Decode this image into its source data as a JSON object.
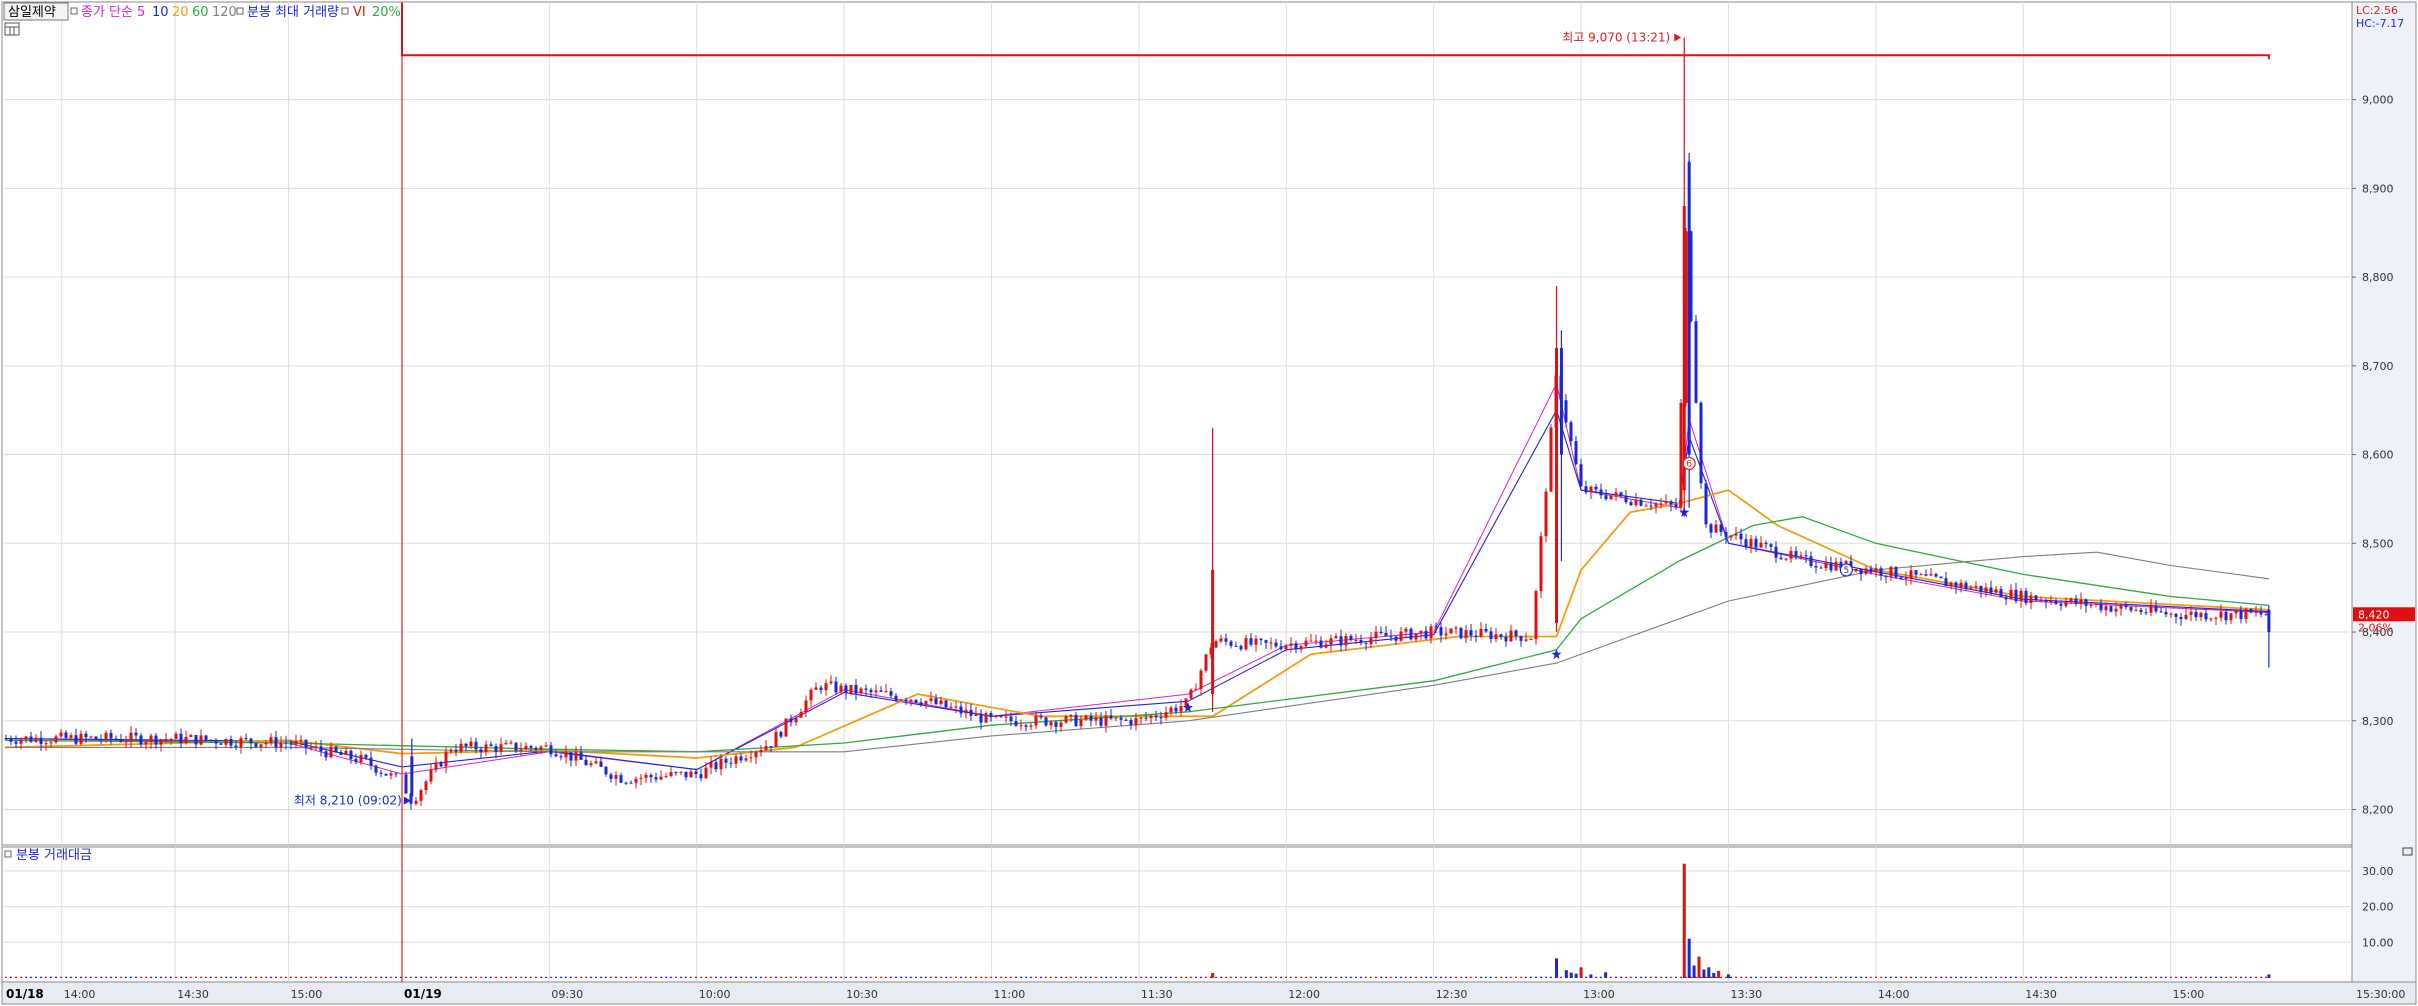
{
  "legend": {
    "stock_name": "삼일제약",
    "ma_label": "종가 단순",
    "ma_periods": [
      "5",
      "10",
      "20",
      "60",
      "120"
    ],
    "ma_colors": [
      "#e01fd0",
      "#1a28d4",
      "#f39c12",
      "#2eaa3e",
      "#7f7f7f"
    ],
    "volume_overlay_label": "분봉 최대 거래량",
    "vi_label": "VI",
    "vi_pct": "20%"
  },
  "corner": {
    "lc": "LC:2.56",
    "hc": "HC:-7.17"
  },
  "annotations": {
    "high_label": "최고 9,070 (13:21)",
    "low_label": "최저 8,210 (09:02)",
    "current_price": "8,420",
    "current_change": "2.06%",
    "marker_six": "6",
    "marker_five": "5"
  },
  "volume_panel": {
    "title": "분봉 거래대금",
    "y_labels": [
      "30.00",
      "20.00",
      "10.00"
    ]
  },
  "time_axis": {
    "date_labels": [
      "01/18",
      "01/19"
    ],
    "labels": [
      "14:00",
      "14:30",
      "15:00",
      "09:30",
      "10:00",
      "10:30",
      "11:00",
      "11:30",
      "12:00",
      "12:30",
      "13:00",
      "13:30",
      "14:00",
      "14:30",
      "15:00",
      "15:30:00"
    ]
  },
  "chart_data": {
    "type": "candlestick",
    "y_ticks": [
      8200,
      8300,
      8400,
      8500,
      8600,
      8700,
      8800,
      8900,
      9000
    ],
    "y_tick_labels": [
      "8,200",
      "8,300",
      "8,400",
      "8,500",
      "8,600",
      "8,700",
      "8,800",
      "8,900",
      "9,000"
    ],
    "ylim": [
      8160,
      9110
    ],
    "high": 9070,
    "low": 8210,
    "current": 8420,
    "vi_level": 9050,
    "price_path": [
      [
        "01/18 13:45",
        8280
      ],
      [
        "01/18 14:30",
        8280
      ],
      [
        "01/18 15:00",
        8275
      ],
      [
        "01/18 15:20",
        8255
      ],
      [
        "09:00",
        8230
      ],
      [
        "09:02",
        8210
      ],
      [
        "09:10",
        8270
      ],
      [
        "09:30",
        8270
      ],
      [
        "09:45",
        8235
      ],
      [
        "10:00",
        8240
      ],
      [
        "10:15",
        8275
      ],
      [
        "10:25",
        8340
      ],
      [
        "10:30",
        8335
      ],
      [
        "10:45",
        8325
      ],
      [
        "11:00",
        8300
      ],
      [
        "11:30",
        8300
      ],
      [
        "11:40",
        8320
      ],
      [
        "11:45",
        8390
      ],
      [
        "11:55",
        8385
      ],
      [
        "12:10",
        8390
      ],
      [
        "12:30",
        8400
      ],
      [
        "12:50",
        8395
      ],
      [
        "12:55",
        8690
      ],
      [
        "13:00",
        8560
      ],
      [
        "13:10",
        8550
      ],
      [
        "13:20",
        8540
      ],
      [
        "13:21",
        8880
      ],
      [
        "13:25",
        8520
      ],
      [
        "13:35",
        8500
      ],
      [
        "13:45",
        8480
      ],
      [
        "14:00",
        8470
      ],
      [
        "14:30",
        8440
      ],
      [
        "15:00",
        8420
      ],
      [
        "15:20",
        8420
      ]
    ],
    "moving_averages": [
      {
        "name": "5",
        "points": [
          [
            "01/18 13:45",
            8280
          ],
          [
            "01/18 15:00",
            8275
          ],
          [
            "09:00",
            8240
          ],
          [
            "09:30",
            8265
          ],
          [
            "10:00",
            8245
          ],
          [
            "10:30",
            8335
          ],
          [
            "11:00",
            8305
          ],
          [
            "11:40",
            8330
          ],
          [
            "12:00",
            8385
          ],
          [
            "12:30",
            8400
          ],
          [
            "12:55",
            8680
          ],
          [
            "13:00",
            8560
          ],
          [
            "13:20",
            8540
          ],
          [
            "13:22",
            8640
          ],
          [
            "13:30",
            8500
          ],
          [
            "14:00",
            8465
          ],
          [
            "14:30",
            8435
          ],
          [
            "15:20",
            8422
          ]
        ]
      },
      {
        "name": "10",
        "points": [
          [
            "01/18 13:45",
            8280
          ],
          [
            "01/18 15:00",
            8277
          ],
          [
            "09:00",
            8248
          ],
          [
            "09:30",
            8266
          ],
          [
            "10:00",
            8245
          ],
          [
            "10:30",
            8332
          ],
          [
            "11:00",
            8305
          ],
          [
            "11:40",
            8322
          ],
          [
            "12:00",
            8380
          ],
          [
            "12:30",
            8397
          ],
          [
            "12:55",
            8650
          ],
          [
            "13:00",
            8560
          ],
          [
            "13:20",
            8545
          ],
          [
            "13:22",
            8620
          ],
          [
            "13:30",
            8500
          ],
          [
            "14:00",
            8468
          ],
          [
            "14:30",
            8437
          ],
          [
            "15:20",
            8423
          ]
        ]
      },
      {
        "name": "20",
        "points": [
          [
            "01/18 13:45",
            8270
          ],
          [
            "01/18 15:00",
            8278
          ],
          [
            "09:00",
            8263
          ],
          [
            "09:30",
            8267
          ],
          [
            "10:00",
            8258
          ],
          [
            "10:20",
            8270
          ],
          [
            "10:45",
            8330
          ],
          [
            "11:10",
            8305
          ],
          [
            "11:45",
            8305
          ],
          [
            "12:05",
            8375
          ],
          [
            "12:35",
            8395
          ],
          [
            "12:55",
            8395
          ],
          [
            "13:00",
            8470
          ],
          [
            "13:10",
            8535
          ],
          [
            "13:20",
            8545
          ],
          [
            "13:30",
            8560
          ],
          [
            "13:40",
            8520
          ],
          [
            "14:00",
            8470
          ],
          [
            "14:30",
            8440
          ],
          [
            "15:20",
            8425
          ]
        ]
      },
      {
        "name": "60",
        "points": [
          [
            "01/18 13:45",
            8278
          ],
          [
            "01/18 15:00",
            8275
          ],
          [
            "09:30",
            8268
          ],
          [
            "10:00",
            8265
          ],
          [
            "10:30",
            8275
          ],
          [
            "11:00",
            8295
          ],
          [
            "11:40",
            8310
          ],
          [
            "12:30",
            8345
          ],
          [
            "12:55",
            8380
          ],
          [
            "13:00",
            8415
          ],
          [
            "13:20",
            8480
          ],
          [
            "13:35",
            8520
          ],
          [
            "13:45",
            8530
          ],
          [
            "14:00",
            8500
          ],
          [
            "14:30",
            8465
          ],
          [
            "15:00",
            8440
          ],
          [
            "15:20",
            8430
          ]
        ]
      },
      {
        "name": "120",
        "points": [
          [
            "01/18 13:45",
            8270
          ],
          [
            "01/18 15:00",
            8270
          ],
          [
            "09:30",
            8265
          ],
          [
            "10:00",
            8265
          ],
          [
            "10:30",
            8265
          ],
          [
            "11:00",
            8283
          ],
          [
            "11:40",
            8300
          ],
          [
            "12:30",
            8340
          ],
          [
            "12:55",
            8365
          ],
          [
            "13:10",
            8395
          ],
          [
            "13:30",
            8435
          ],
          [
            "14:00",
            8470
          ],
          [
            "14:30",
            8485
          ],
          [
            "14:45",
            8490
          ],
          [
            "15:00",
            8475
          ],
          [
            "15:20",
            8460
          ]
        ]
      }
    ],
    "volume_spikes": [
      [
        "11:45",
        1.4
      ],
      [
        "12:55",
        5.5
      ],
      [
        "13:00",
        3.0
      ],
      [
        "13:05",
        1.6
      ],
      [
        "13:21",
        32
      ],
      [
        "13:22",
        11
      ],
      [
        "13:24",
        6
      ],
      [
        "13:26",
        3
      ],
      [
        "13:28",
        2
      ],
      [
        "15:20",
        1.0
      ]
    ],
    "volume_ylim": [
      0,
      35
    ],
    "grid": true
  }
}
